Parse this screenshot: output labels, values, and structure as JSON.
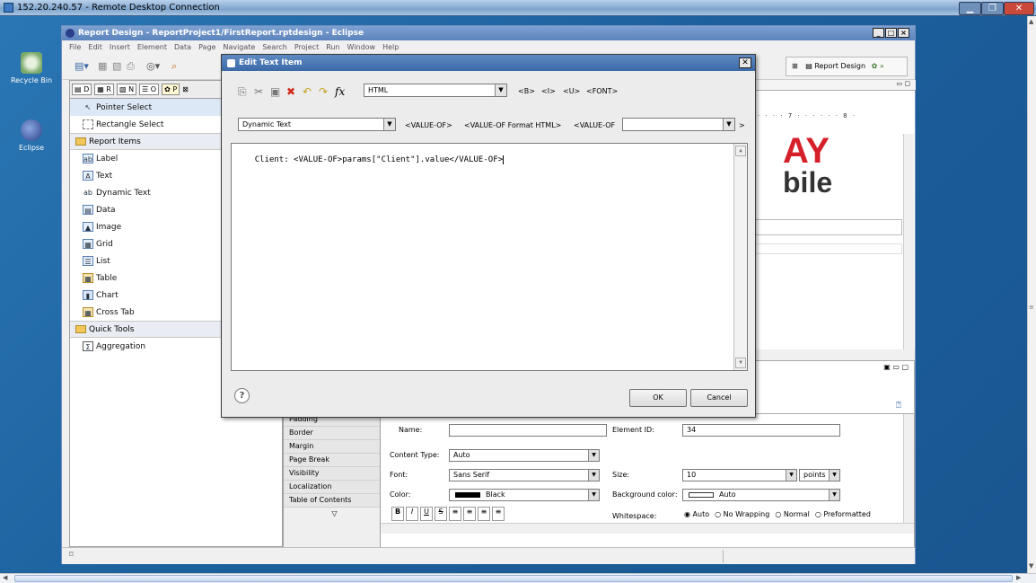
{
  "rdp": {
    "title": "152.20.240.57 - Remote Desktop Connection"
  },
  "desktop": {
    "icons": [
      {
        "label": "Recycle Bin"
      },
      {
        "label": "Eclipse"
      }
    ]
  },
  "eclipse": {
    "title": "Report Design - ReportProject1/FirstReport.rptdesign - Eclipse",
    "menu": [
      "File",
      "Edit",
      "Insert",
      "Element",
      "Data",
      "Page",
      "Navigate",
      "Search",
      "Project",
      "Run",
      "Window",
      "Help"
    ],
    "perspective": "Report Design",
    "palette": {
      "tabs": [
        "D",
        "R",
        "N",
        "O",
        "P"
      ],
      "tools": [
        "Pointer Select",
        "Rectangle Select"
      ],
      "category_report_items": "Report Items",
      "report_items": [
        "Label",
        "Text",
        "Dynamic Text",
        "Data",
        "Image",
        "Grid",
        "List",
        "Table",
        "Chart",
        "Cross Tab"
      ],
      "category_quick_tools": "Quick Tools",
      "quick_tools": [
        "Aggregation"
      ]
    },
    "editor": {
      "logo_line1": "AY",
      "logo_line2": "bile"
    },
    "properties": {
      "nav": [
        "Padding",
        "Border",
        "Margin",
        "Page Break",
        "Visibility",
        "Localization",
        "Table of Contents"
      ],
      "name_label": "Name:",
      "name_value": "",
      "element_id_label": "Element ID:",
      "element_id_value": "34",
      "content_type_label": "Content Type:",
      "content_type_value": "Auto",
      "font_label": "Font:",
      "font_value": "Sans Serif",
      "size_label": "Size:",
      "size_value": "10",
      "size_unit": "points",
      "color_label": "Color:",
      "color_value": "Black",
      "bg_color_label": "Background color:",
      "bg_color_value": "Auto",
      "whitespace_label": "Whitespace:",
      "whitespace_options": [
        "Auto",
        "No Wrapping",
        "Normal",
        "Preformatted"
      ],
      "format_buttons": [
        "B",
        "I",
        "U",
        "S"
      ]
    }
  },
  "dialog": {
    "title": "Edit Text Item",
    "content_type": "HTML",
    "html_tags": [
      "<B>",
      "<I>",
      "<U>",
      "<FONT>"
    ],
    "dynamic_combo": "Dynamic Text",
    "value_tags": [
      "<VALUE-OF>",
      "<VALUE-OF Format HTML>",
      "<VALUE-OF"
    ],
    "more": ">",
    "text": "Client: <VALUE-OF>params[\"Client\"].value</VALUE-OF>",
    "ok": "OK",
    "cancel": "Cancel",
    "help": "?"
  }
}
